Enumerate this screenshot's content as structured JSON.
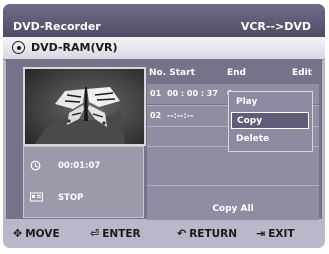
{
  "window": {
    "title": "DVD-Recorder",
    "mode": "VCR-->DVD"
  },
  "disc": {
    "label": "DVD-RAM(VR)",
    "icon": "disc-icon"
  },
  "info": {
    "time": "00:01:07",
    "status": "STOP",
    "time_icon": "clock-icon",
    "status_icon": "stop-status-icon"
  },
  "list": {
    "headers": {
      "no_start": "No. Start",
      "end": "End",
      "edit": "Edit"
    },
    "rows": [
      {
        "no": "01",
        "start": "00 : 00 : 37",
        "end_partial": "0"
      },
      {
        "no": "02",
        "start": "--:--:--",
        "end_partial": ""
      }
    ],
    "copy_all": "Copy All"
  },
  "popup_menu": {
    "items": [
      "Play",
      "Copy",
      "Delete"
    ],
    "selected": "Copy"
  },
  "footer": {
    "move": "MOVE",
    "enter": "ENTER",
    "return": "RETURN",
    "exit": "EXIT"
  },
  "colors": {
    "panel": "#b9b7c9",
    "titlebar": "#5d5b75",
    "content": "#74738a",
    "highlight": "#5f5d7a"
  }
}
